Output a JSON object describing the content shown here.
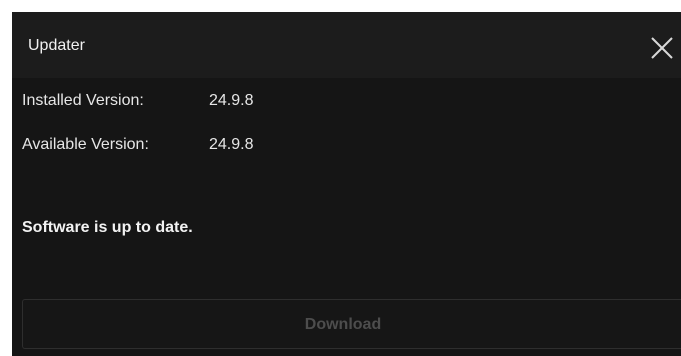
{
  "window": {
    "title": "Updater",
    "close_icon": "close-icon"
  },
  "versions": {
    "installed_label": "Installed Version:",
    "installed_value": "24.9.8",
    "available_label": "Available Version:",
    "available_value": "24.9.8"
  },
  "status": {
    "message": "Software is up to date."
  },
  "actions": {
    "download_label": "Download",
    "download_enabled": false
  },
  "colors": {
    "window_background": "#151515",
    "titlebar_background": "#1c1c1c",
    "text": "#e6e6e6",
    "disabled_text": "#4d4d4d"
  }
}
